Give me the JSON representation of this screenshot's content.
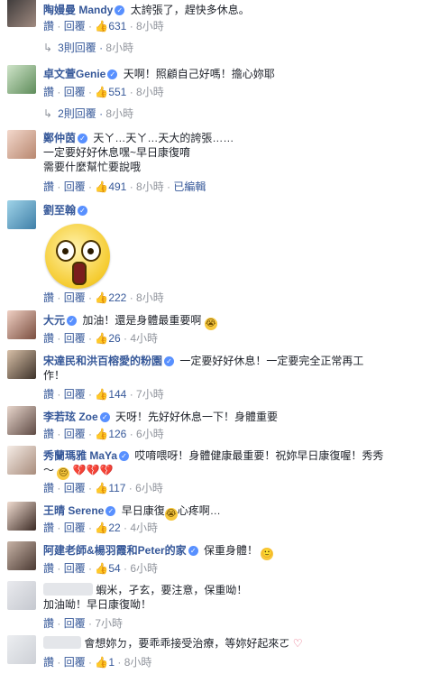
{
  "labels": {
    "like": "讚",
    "reply": "回覆",
    "sep": "·"
  },
  "comments": [
    {
      "name": "陶嫚曼 Mandy",
      "text": "太誇張了，趕快多休息。",
      "likes": "631",
      "time": "8小時",
      "edited": "",
      "replies": {
        "label": "3則回覆",
        "time": "8小時"
      }
    },
    {
      "name": "卓文萱Genie",
      "text": "天啊！照顧自己好嗎！擔心妳耶",
      "likes": "551",
      "time": "8小時",
      "edited": "",
      "replies": {
        "label": "2則回覆",
        "time": "8小時"
      }
    },
    {
      "name": "鄭仲茵",
      "text": "天ㄚ…天ㄚ…天大的誇張……\n一定要好好休息嘿~早日康復唷\n需要什麼幫忙要說哦",
      "likes": "491",
      "time": "8小時",
      "edited": "已編輯"
    },
    {
      "name": "劉至翰",
      "text": "",
      "likes": "222",
      "time": "8小時",
      "edited": ""
    },
    {
      "name": "大元",
      "text": "加油！還是身體最重要啊",
      "likes": "26",
      "time": "4小時",
      "edited": ""
    },
    {
      "name": "宋達民和洪百榕愛的粉園",
      "text": "一定要好好休息！一定要完全正常再工\n作！",
      "likes": "144",
      "time": "7小時",
      "edited": ""
    },
    {
      "name": "李若玹 Zoe",
      "text": "天呀！先好好休息一下！身體重要",
      "likes": "126",
      "time": "6小時",
      "edited": ""
    },
    {
      "name": "秀蘭瑪雅 MaYa",
      "text": "哎唷喂呀！身體健康最重要！祝妳早日康復喔！秀秀\n～",
      "likes": "117",
      "time": "6小時",
      "edited": ""
    },
    {
      "name": "王晴 Serene",
      "text": "早日康復",
      "text_after": "心疼啊…",
      "likes": "22",
      "time": "4小時",
      "edited": ""
    },
    {
      "name": "阿建老師&楊羽霞和Peter的家",
      "text": "保重身體！",
      "likes": "54",
      "time": "6小時",
      "edited": ""
    },
    {
      "name": "",
      "text": "蝦米，孑玄，要注意，保重呦！\n加油呦！早日康復呦！",
      "likes": "",
      "time": "7小時",
      "edited": ""
    },
    {
      "name": "",
      "text": "會想妳ㄉ，要乖乖接受治療，等妳好起來ㄛ",
      "likes": "1",
      "time": "8小時",
      "edited": ""
    }
  ],
  "colors": {
    "link": "#365899",
    "meta": "#90949c",
    "verified": "#5890ff"
  }
}
